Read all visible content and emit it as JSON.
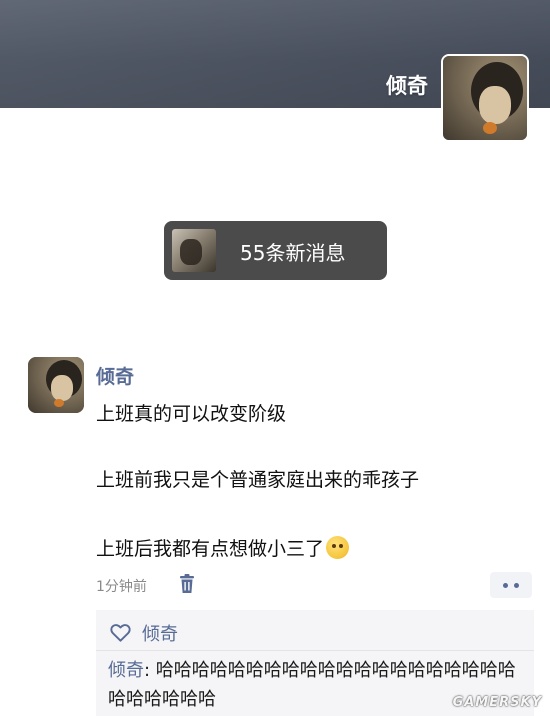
{
  "profile": {
    "name": "倾奇",
    "avatar_icon": "girl-portrait-avatar"
  },
  "notification": {
    "label": "55条新消息",
    "thumb_icon": "sender-avatar-thumbnail"
  },
  "post": {
    "author": "倾奇",
    "lines": [
      "上班真的可以改变阶级",
      "上班前我只是个普通家庭出来的乖孩子",
      "上班后我都有点想做小三了"
    ],
    "emoji": "crying-laughing-face-emoji",
    "time": "1分钟前",
    "delete_icon": "trash-icon",
    "more_icon": "more-dots-icon"
  },
  "interactions": {
    "like_icon": "heart-outline-icon",
    "likes": "倾奇",
    "comment": {
      "author": "倾奇",
      "separator": ": ",
      "text": "哈哈哈哈哈哈哈哈哈哈哈哈哈哈哈哈哈哈哈哈哈哈哈哈哈哈"
    }
  },
  "watermark": "GAMERSKY",
  "colors": {
    "link": "#576b95",
    "cover": "#4b5260",
    "notification_bg": "#4b4b4b",
    "comment_bg": "#f5f5f7"
  }
}
